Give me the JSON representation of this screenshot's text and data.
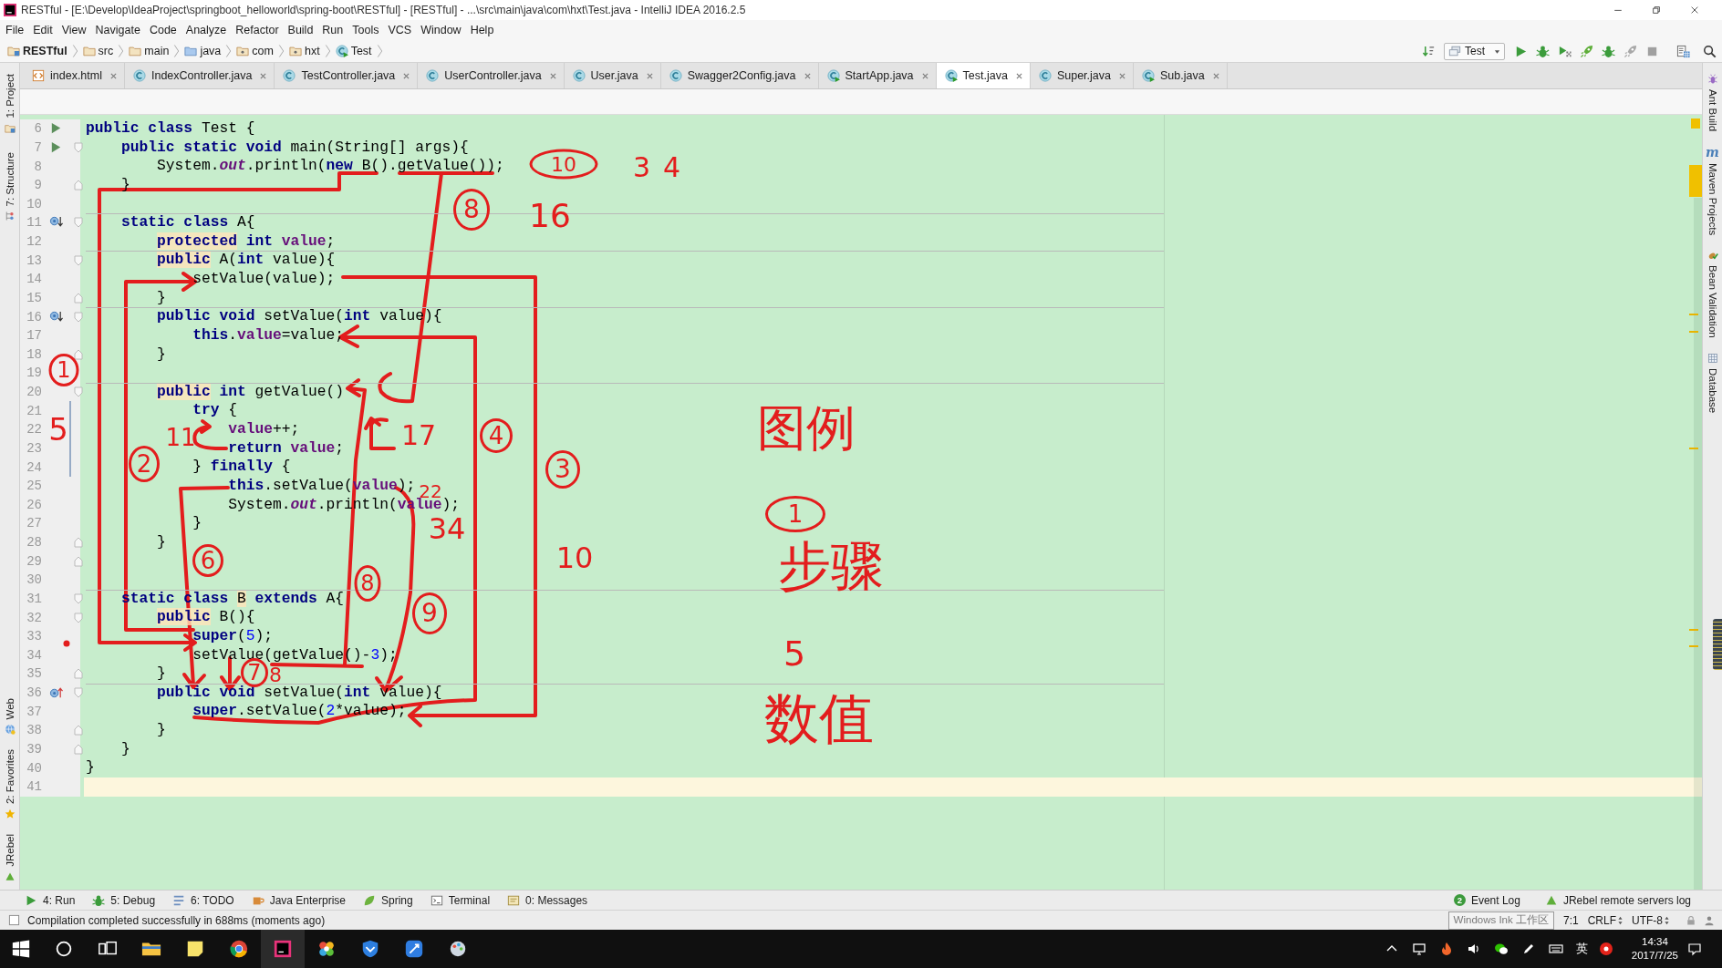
{
  "window": {
    "title": "RESTful - [E:\\Develop\\IdeaProject\\springboot_helloworld\\spring-boot\\RESTful] - [RESTful] - ...\\src\\main\\java\\com\\hxt\\Test.java - IntelliJ IDEA 2016.2.5"
  },
  "menu": [
    "File",
    "Edit",
    "View",
    "Navigate",
    "Code",
    "Analyze",
    "Refactor",
    "Build",
    "Run",
    "Tools",
    "VCS",
    "Window",
    "Help"
  ],
  "breadcrumbs": [
    {
      "label": "RESTful",
      "kind": "project"
    },
    {
      "label": "src",
      "kind": "folder"
    },
    {
      "label": "main",
      "kind": "folder"
    },
    {
      "label": "java",
      "kind": "source_folder"
    },
    {
      "label": "com",
      "kind": "package"
    },
    {
      "label": "hxt",
      "kind": "package"
    },
    {
      "label": "Test",
      "kind": "class"
    }
  ],
  "run_config": {
    "label": "Test"
  },
  "tabs": [
    {
      "label": "index.html",
      "kind": "html",
      "selected": false
    },
    {
      "label": "IndexController.java",
      "kind": "class",
      "selected": false
    },
    {
      "label": "TestController.java",
      "kind": "class",
      "selected": false
    },
    {
      "label": "UserController.java",
      "kind": "class",
      "selected": false
    },
    {
      "label": "User.java",
      "kind": "class",
      "selected": false
    },
    {
      "label": "Swagger2Config.java",
      "kind": "class",
      "selected": false
    },
    {
      "label": "StartApp.java",
      "kind": "runnable_class",
      "selected": false
    },
    {
      "label": "Test.java",
      "kind": "runnable_class",
      "selected": true
    },
    {
      "label": "Super.java",
      "kind": "class",
      "selected": false
    },
    {
      "label": "Sub.java",
      "kind": "runnable_class",
      "selected": false
    }
  ],
  "left_toolbar": {
    "top": [
      {
        "label": "1: Project",
        "kind": "project"
      },
      {
        "label": "7: Structure",
        "kind": "structure"
      }
    ],
    "bottom": [
      {
        "label": "Web",
        "kind": "web"
      },
      {
        "label": "2: Favorites",
        "kind": "favorites"
      },
      {
        "label": "JRebel",
        "kind": "jrebel"
      }
    ]
  },
  "right_toolbar": [
    {
      "label": "Ant Build",
      "kind": "ant"
    },
    {
      "label": "Maven Projects",
      "kind": "maven",
      "glyph": "m"
    },
    {
      "label": "Bean Validation",
      "kind": "bean"
    },
    {
      "label": "Database",
      "kind": "database"
    }
  ],
  "editor": {
    "lines": [
      {
        "number": "6",
        "tokens": [
          {
            "text": "public class",
            "kind": "keyword"
          },
          {
            "text": " Test {",
            "kind": "plain"
          }
        ],
        "gutter_icon": {
          "kind": "run"
        },
        "separator_above": false,
        "current": false,
        "changed": false
      },
      {
        "number": "7",
        "tokens": [
          {
            "text": "    public static void",
            "kind": "keyword"
          },
          {
            "text": " main(String[] args){",
            "kind": "plain"
          }
        ],
        "gutter_icon": {
          "kind": "run"
        },
        "fold_marker": {
          "kind": "start"
        },
        "separator_above": false,
        "current": false,
        "changed": false
      },
      {
        "number": "8",
        "tokens": [
          {
            "text": "        System.",
            "kind": "plain"
          },
          {
            "text": "out",
            "kind": "static_field"
          },
          {
            "text": ".println(",
            "kind": "plain"
          },
          {
            "text": "new",
            "kind": "keyword"
          },
          {
            "text": " B().getValue());",
            "kind": "plain"
          }
        ],
        "separator_above": false,
        "current": false,
        "changed": false
      },
      {
        "number": "9",
        "tokens": [
          {
            "text": "    }",
            "kind": "plain"
          }
        ],
        "fold_marker": {
          "kind": "end"
        },
        "separator_above": false,
        "current": false,
        "changed": false
      },
      {
        "number": "10",
        "separator_above": false,
        "current": false,
        "changed": false
      },
      {
        "number": "11",
        "tokens": [
          {
            "text": "    static class",
            "kind": "keyword"
          },
          {
            "text": " A{",
            "kind": "plain"
          }
        ],
        "gutter_icon": {
          "kind": "overridden"
        },
        "fold_marker": {
          "kind": "start"
        },
        "separator_above": true,
        "current": false,
        "changed": false
      },
      {
        "number": "12",
        "tokens": [
          {
            "text": "        protected",
            "kind": "warned_keyword"
          },
          {
            "text": " int",
            "kind": "keyword"
          },
          {
            "text": " value",
            "kind": "field"
          },
          {
            "text": ";",
            "kind": "plain"
          }
        ],
        "separator_above": false,
        "current": false,
        "changed": false
      },
      {
        "number": "13",
        "tokens": [
          {
            "text": "        public",
            "kind": "warned_keyword"
          },
          {
            "text": " A(",
            "kind": "plain"
          },
          {
            "text": "int",
            "kind": "keyword"
          },
          {
            "text": " value){",
            "kind": "plain"
          }
        ],
        "fold_marker": {
          "kind": "start"
        },
        "separator_above": true,
        "current": false,
        "changed": false
      },
      {
        "number": "14",
        "tokens": [
          {
            "text": "            setValue(value);",
            "kind": "plain"
          }
        ],
        "separator_above": false,
        "current": false,
        "changed": false
      },
      {
        "number": "15",
        "tokens": [
          {
            "text": "        }",
            "kind": "plain"
          }
        ],
        "fold_marker": {
          "kind": "end"
        },
        "separator_above": false,
        "current": false,
        "changed": false
      },
      {
        "number": "16",
        "tokens": [
          {
            "text": "        public void",
            "kind": "keyword"
          },
          {
            "text": " setValue(",
            "kind": "plain"
          },
          {
            "text": "int",
            "kind": "keyword"
          },
          {
            "text": " value){",
            "kind": "plain"
          }
        ],
        "gutter_icon": {
          "kind": "overridden"
        },
        "fold_marker": {
          "kind": "start"
        },
        "separator_above": true,
        "current": false,
        "changed": false
      },
      {
        "number": "17",
        "tokens": [
          {
            "text": "            this",
            "kind": "keyword"
          },
          {
            "text": ".",
            "kind": "plain"
          },
          {
            "text": "value",
            "kind": "field"
          },
          {
            "text": "=value;",
            "kind": "plain"
          }
        ],
        "separator_above": false,
        "current": false,
        "changed": false
      },
      {
        "number": "18",
        "tokens": [
          {
            "text": "        }",
            "kind": "plain"
          }
        ],
        "fold_marker": {
          "kind": "end"
        },
        "separator_above": false,
        "current": false,
        "changed": false
      },
      {
        "number": "19",
        "separator_above": false,
        "current": false,
        "changed": false
      },
      {
        "number": "20",
        "tokens": [
          {
            "text": "        public",
            "kind": "warned_keyword"
          },
          {
            "text": " int",
            "kind": "keyword"
          },
          {
            "text": " getValue()",
            "kind": "plain"
          }
        ],
        "fold_marker": {
          "kind": "start"
        },
        "separator_above": true,
        "current": false,
        "changed": false
      },
      {
        "number": "21",
        "tokens": [
          {
            "text": "            try",
            "kind": "keyword"
          },
          {
            "text": " {",
            "kind": "plain"
          }
        ],
        "separator_above": false,
        "current": false,
        "changed": true
      },
      {
        "number": "22",
        "tokens": [
          {
            "text": "                value",
            "kind": "field"
          },
          {
            "text": "++;",
            "kind": "plain"
          }
        ],
        "separator_above": false,
        "current": false,
        "changed": true
      },
      {
        "number": "23",
        "tokens": [
          {
            "text": "                return",
            "kind": "keyword"
          },
          {
            "text": " value",
            "kind": "field"
          },
          {
            "text": ";",
            "kind": "plain"
          }
        ],
        "separator_above": false,
        "current": false,
        "changed": true
      },
      {
        "number": "24",
        "tokens": [
          {
            "text": "            } ",
            "kind": "plain"
          },
          {
            "text": "finally",
            "kind": "keyword"
          },
          {
            "text": " {",
            "kind": "plain"
          }
        ],
        "separator_above": false,
        "current": false,
        "changed": true
      },
      {
        "number": "25",
        "tokens": [
          {
            "text": "                this",
            "kind": "keyword"
          },
          {
            "text": ".setValue(",
            "kind": "plain"
          },
          {
            "text": "value",
            "kind": "field"
          },
          {
            "text": ");",
            "kind": "plain"
          }
        ],
        "separator_above": false,
        "current": false,
        "changed": false
      },
      {
        "number": "26",
        "tokens": [
          {
            "text": "                System.",
            "kind": "plain"
          },
          {
            "text": "out",
            "kind": "static_field"
          },
          {
            "text": ".println(",
            "kind": "plain"
          },
          {
            "text": "value",
            "kind": "field"
          },
          {
            "text": ");",
            "kind": "plain"
          }
        ],
        "separator_above": false,
        "current": false,
        "changed": false
      },
      {
        "number": "27",
        "tokens": [
          {
            "text": "            }",
            "kind": "plain"
          }
        ],
        "separator_above": false,
        "current": false,
        "changed": false
      },
      {
        "number": "28",
        "tokens": [
          {
            "text": "        }",
            "kind": "plain"
          }
        ],
        "fold_marker": {
          "kind": "end"
        },
        "separator_above": false,
        "current": false,
        "changed": false
      },
      {
        "number": "29",
        "fold_marker": {
          "kind": "end"
        },
        "separator_above": false,
        "current": false,
        "changed": false
      },
      {
        "number": "30",
        "separator_above": false,
        "current": false,
        "changed": false
      },
      {
        "number": "31",
        "tokens": [
          {
            "text": "    static class",
            "kind": "keyword"
          },
          {
            "text": " B",
            "kind": "warned_plain"
          },
          {
            "text": " extends",
            "kind": "keyword"
          },
          {
            "text": " A{",
            "kind": "plain"
          }
        ],
        "fold_marker": {
          "kind": "start"
        },
        "separator_above": true,
        "current": false,
        "changed": false
      },
      {
        "number": "32",
        "tokens": [
          {
            "text": "        public",
            "kind": "warned_keyword"
          },
          {
            "text": " B(){",
            "kind": "plain"
          }
        ],
        "fold_marker": {
          "kind": "start"
        },
        "separator_above": false,
        "current": false,
        "changed": false
      },
      {
        "number": "33",
        "tokens": [
          {
            "text": "            super",
            "kind": "keyword"
          },
          {
            "text": "(",
            "kind": "plain"
          },
          {
            "text": "5",
            "kind": "number"
          },
          {
            "text": ");",
            "kind": "plain"
          }
        ],
        "separator_above": false,
        "current": false,
        "changed": false
      },
      {
        "number": "34",
        "tokens": [
          {
            "text": "            setValue(getValue()-",
            "kind": "plain"
          },
          {
            "text": "3",
            "kind": "number"
          },
          {
            "text": ");",
            "kind": "plain"
          }
        ],
        "separator_above": false,
        "current": false,
        "changed": false
      },
      {
        "number": "35",
        "tokens": [
          {
            "text": "        }",
            "kind": "plain"
          }
        ],
        "fold_marker": {
          "kind": "end"
        },
        "separator_above": false,
        "current": false,
        "changed": false
      },
      {
        "number": "36",
        "tokens": [
          {
            "text": "        public void",
            "kind": "keyword"
          },
          {
            "text": " setValue(",
            "kind": "plain"
          },
          {
            "text": "int",
            "kind": "keyword"
          },
          {
            "text": " value){",
            "kind": "plain"
          }
        ],
        "gutter_icon": {
          "kind": "overrides"
        },
        "fold_marker": {
          "kind": "start"
        },
        "separator_above": true,
        "current": false,
        "changed": false
      },
      {
        "number": "37",
        "tokens": [
          {
            "text": "            super",
            "kind": "keyword"
          },
          {
            "text": ".setValue(",
            "kind": "plain"
          },
          {
            "text": "2",
            "kind": "number"
          },
          {
            "text": "*value);",
            "kind": "plain"
          }
        ],
        "separator_above": false,
        "current": false,
        "changed": false
      },
      {
        "number": "38",
        "tokens": [
          {
            "text": "        }",
            "kind": "plain"
          }
        ],
        "fold_marker": {
          "kind": "end"
        },
        "separator_above": false,
        "current": false,
        "changed": false
      },
      {
        "number": "39",
        "tokens": [
          {
            "text": "    }",
            "kind": "plain"
          }
        ],
        "fold_marker": {
          "kind": "end"
        },
        "separator_above": false,
        "current": false,
        "changed": false
      },
      {
        "number": "40",
        "tokens": [
          {
            "text": "}",
            "kind": "plain"
          }
        ],
        "separator_above": false,
        "current": false,
        "changed": false
      },
      {
        "number": "41",
        "separator_above": false,
        "current": true,
        "changed": false
      }
    ]
  },
  "handwritten_notes": [
    {
      "text": "10",
      "kind": "circled"
    },
    {
      "text": "34",
      "kind": "plain"
    },
    {
      "text": "8",
      "kind": "circled"
    },
    {
      "text": "16",
      "kind": "plain"
    },
    {
      "text": "1",
      "kind": "circled"
    },
    {
      "text": "5",
      "kind": "plain"
    },
    {
      "text": "11",
      "kind": "plain"
    },
    {
      "text": "17",
      "kind": "plain"
    },
    {
      "text": "4",
      "kind": "circled"
    },
    {
      "text": "2",
      "kind": "circled"
    },
    {
      "text": "3",
      "kind": "circled"
    },
    {
      "text": "22",
      "kind": "plain"
    },
    {
      "text": "34",
      "kind": "plain"
    },
    {
      "text": "6",
      "kind": "circled"
    },
    {
      "text": "10",
      "kind": "plain"
    },
    {
      "text": "8",
      "kind": "circled"
    },
    {
      "text": "9",
      "kind": "circled"
    },
    {
      "text": "7",
      "kind": "circled"
    },
    {
      "text": "8",
      "kind": "plain"
    }
  ],
  "legend": [
    {
      "text": "图例",
      "kind": "plain"
    },
    {
      "text": "1",
      "kind": "circled"
    },
    {
      "text": "步骤",
      "kind": "plain"
    },
    {
      "text": "5",
      "kind": "plain"
    },
    {
      "text": "数值",
      "kind": "plain"
    }
  ],
  "tool_windows": [
    {
      "label": "4: Run",
      "kind": "run"
    },
    {
      "label": "5: Debug",
      "kind": "debug"
    },
    {
      "label": "6: TODO",
      "kind": "todo"
    },
    {
      "label": "Java Enterprise",
      "kind": "javaee"
    },
    {
      "label": "Spring",
      "kind": "spring"
    },
    {
      "label": "Terminal",
      "kind": "terminal"
    },
    {
      "label": "0: Messages",
      "kind": "messages"
    }
  ],
  "event_log": {
    "count": "2",
    "label": "Event Log"
  },
  "jrebel_log": {
    "label": "JRebel remote servers log"
  },
  "status_bar": {
    "message": "Compilation completed successfully in 688ms (moments ago)",
    "tooltip": "Windows Ink 工作区",
    "caret_position": "7:1",
    "line_separator": "CRLF",
    "encoding": "UTF-8"
  },
  "taskbar": {
    "input_method": "英",
    "time": "14:34",
    "date": "2017/7/25"
  }
}
